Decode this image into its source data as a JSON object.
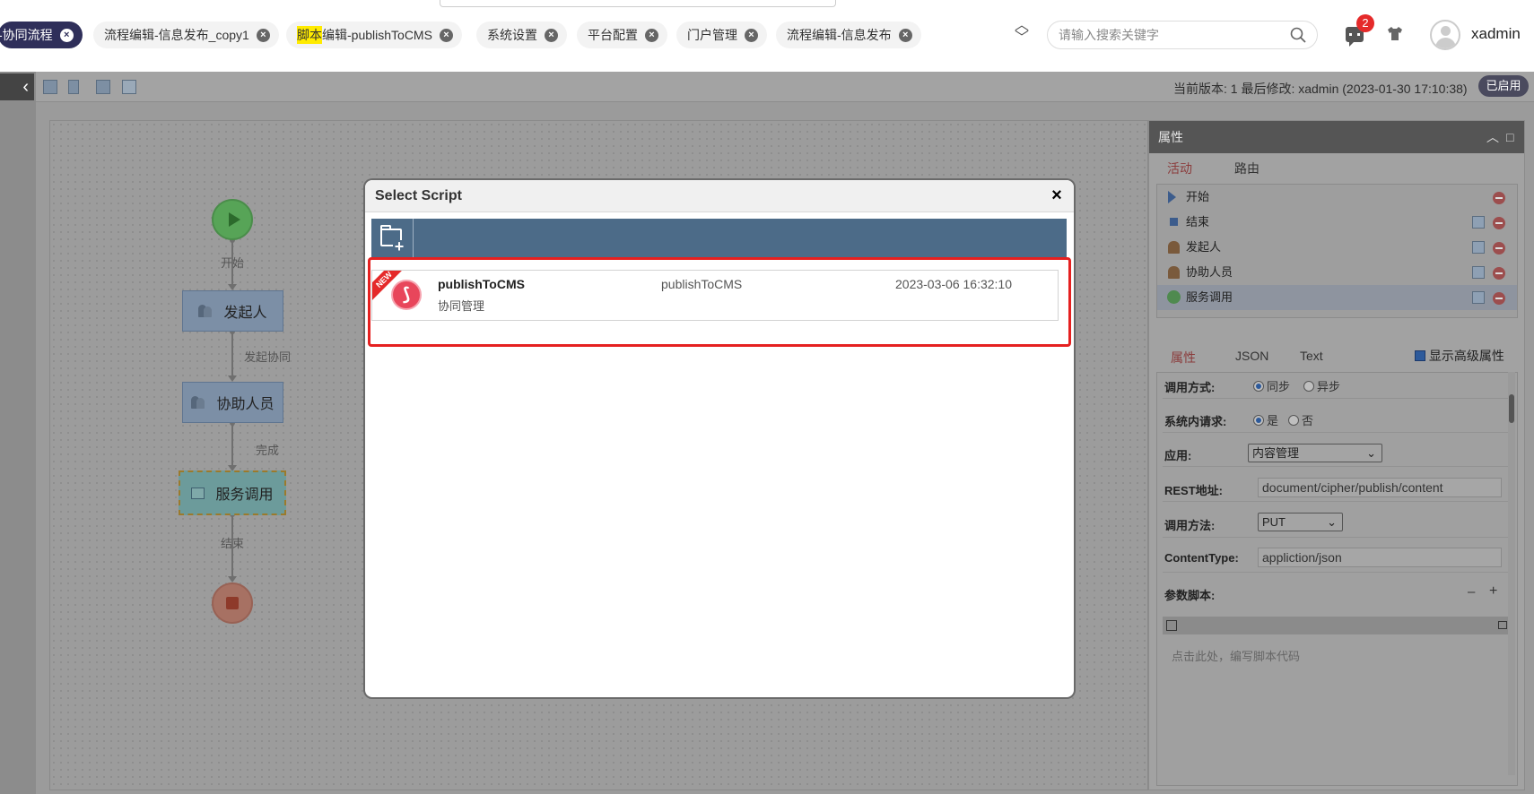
{
  "tabs": [
    {
      "label": "-协同流程",
      "active": true
    },
    {
      "label_highlight": "",
      "label": "流程编辑-信息发布_copy1"
    },
    {
      "label_highlight": "脚本",
      "label": "编辑-publishToCMS"
    },
    {
      "label": "系统设置"
    },
    {
      "label": "平台配置"
    },
    {
      "label": "门户管理"
    },
    {
      "label": "流程编辑-信息发布"
    }
  ],
  "search": {
    "placeholder": "请输入搜索关键字"
  },
  "notifications": {
    "count": "2"
  },
  "user": {
    "name": "xadmin"
  },
  "editor": {
    "version_info": "当前版本: 1 最后修改: xadmin (2023-01-30 17:10:38)",
    "status": "已启用"
  },
  "flow": {
    "nodes": {
      "initiator": "发起人",
      "assistant": "协助人员",
      "service": "服务调用"
    },
    "edges": {
      "start": "开始",
      "collab": "发起协同",
      "done": "完成",
      "end": "结束"
    }
  },
  "properties": {
    "title": "属性",
    "tabs": {
      "activity": "活动",
      "route": "路由"
    },
    "activities": [
      "开始",
      "结束",
      "发起人",
      "协助人员",
      "服务调用"
    ],
    "detail_tabs": {
      "props": "属性",
      "json": "JSON",
      "text": "Text"
    },
    "show_advanced": "显示高级属性",
    "fields": {
      "call_mode_label": "调用方式:",
      "call_mode_sync": "同步",
      "call_mode_async": "异步",
      "internal_label": "系统内请求:",
      "internal_yes": "是",
      "internal_no": "否",
      "app_label": "应用:",
      "app_value": "内容管理",
      "rest_label": "REST地址:",
      "rest_value": "document/cipher/publish/content",
      "method_label": "调用方法:",
      "method_value": "PUT",
      "ctype_label": "ContentType:",
      "ctype_value": "appliction/json",
      "param_label": "参数脚本:",
      "param_minus": "–",
      "param_plus": "+",
      "script_placeholder": "点击此处，编写脚本代码"
    }
  },
  "modal": {
    "title": "Select Script",
    "close": "×",
    "script": {
      "badge": "NEW",
      "name": "publishToCMS",
      "app": "协同管理",
      "alias": "publishToCMS",
      "time": "2023-03-06 16:32:10"
    }
  },
  "colors": {
    "highlight_border": "#e52020",
    "accent": "#2f2f5a",
    "new_badge": "#e52a2a"
  }
}
